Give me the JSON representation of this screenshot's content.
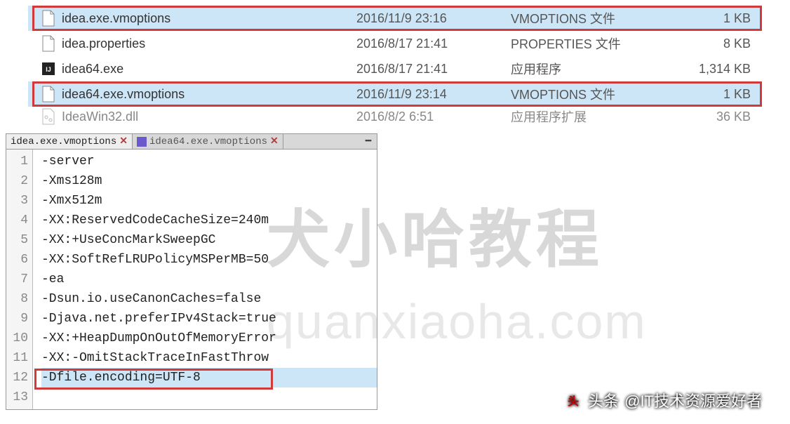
{
  "files": [
    {
      "name": "idea.exe.vmoptions",
      "date": "2016/11/9 23:16",
      "type": "VMOPTIONS 文件",
      "size": "1 KB",
      "icon": "file",
      "selected": true,
      "highlight": true
    },
    {
      "name": "idea.properties",
      "date": "2016/8/17 21:41",
      "type": "PROPERTIES 文件",
      "size": "8 KB",
      "icon": "file",
      "selected": false,
      "highlight": false
    },
    {
      "name": "idea64.exe",
      "date": "2016/8/17 21:41",
      "type": "应用程序",
      "size": "1,314 KB",
      "icon": "exe",
      "selected": false,
      "highlight": false
    },
    {
      "name": "idea64.exe.vmoptions",
      "date": "2016/11/9 23:14",
      "type": "VMOPTIONS 文件",
      "size": "1 KB",
      "icon": "file",
      "selected": true,
      "highlight": true
    },
    {
      "name": "IdeaWin32.dll",
      "date": "2016/8/2 6:51",
      "type": "应用程序扩展",
      "size": "36 KB",
      "icon": "dll",
      "selected": false,
      "highlight": false,
      "cut": true
    }
  ],
  "editor": {
    "tabs": [
      {
        "label": "idea.exe.vmoptions",
        "active": true
      },
      {
        "label": "idea64.exe.vmoptions",
        "active": false
      }
    ],
    "lines": [
      "-server",
      "-Xms128m",
      "-Xmx512m",
      "-XX:ReservedCodeCacheSize=240m",
      "-XX:+UseConcMarkSweepGC",
      "-XX:SoftRefLRUPolicyMSPerMB=50",
      "-ea",
      "-Dsun.io.useCanonCaches=false",
      "-Djava.net.preferIPv4Stack=true",
      "-XX:+HeapDumpOnOutOfMemoryError",
      "-XX:-OmitStackTraceInFastThrow",
      "-Dfile.encoding=UTF-8",
      ""
    ],
    "highlighted_line_index": 11
  },
  "watermark": {
    "line1": "犬小哈教程",
    "line2": "quanxiaoha.com"
  },
  "attribution": {
    "prefix": "头条",
    "handle": "@IT技术资源爱好者"
  }
}
